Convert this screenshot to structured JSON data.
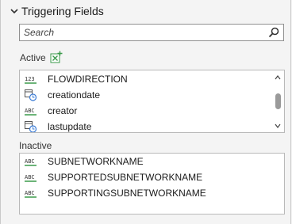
{
  "section": {
    "title": "Triggering Fields",
    "expanded": true
  },
  "search": {
    "placeholder": "Search",
    "value": ""
  },
  "active": {
    "label": "Active",
    "items": [
      {
        "name": "FLOWDIRECTION",
        "type_icon": "numeric-field-icon"
      },
      {
        "name": "creationdate",
        "type_icon": "date-field-icon"
      },
      {
        "name": "creator",
        "type_icon": "text-field-icon"
      },
      {
        "name": "lastupdate",
        "type_icon": "date-field-icon"
      }
    ]
  },
  "inactive": {
    "label": "Inactive",
    "items": [
      {
        "name": "SUBNETWORKNAME",
        "type_icon": "text-field-icon"
      },
      {
        "name": "SUPPORTEDSUBNETWORKNAME",
        "type_icon": "text-field-icon"
      },
      {
        "name": "SUPPORTINGSUBNETWORKNAME",
        "type_icon": "text-field-icon"
      }
    ]
  },
  "colors": {
    "accent_green": "#3a9a4a",
    "text": "#1a1a1a",
    "border": "#b9b9b9"
  }
}
